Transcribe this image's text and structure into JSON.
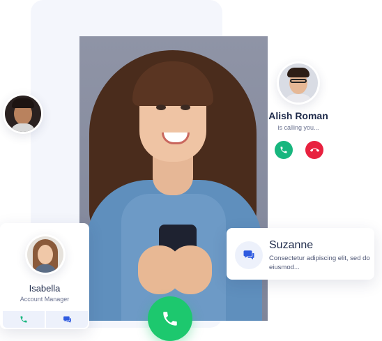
{
  "incoming_call": {
    "caller_name": "Alish Roman",
    "status": "is calling you...",
    "accept_color": "#18b67e",
    "decline_color": "#e8213f"
  },
  "contact_card": {
    "name": "Isabella",
    "role": "Account Manager",
    "actions": [
      "phone-icon",
      "chat-icon"
    ]
  },
  "message_card": {
    "name": "Suzanne",
    "text": "Consectetur adipiscing elit, sed do eiusmod..."
  },
  "icons": {
    "main_call": "phone-icon",
    "accept": "phone-icon",
    "decline": "hang-up-icon",
    "message": "chat-bubbles-icon"
  },
  "colors": {
    "main_call": "#1dc86e",
    "accent_blue": "#2f5be0",
    "text_dark": "#1e2a4a"
  }
}
